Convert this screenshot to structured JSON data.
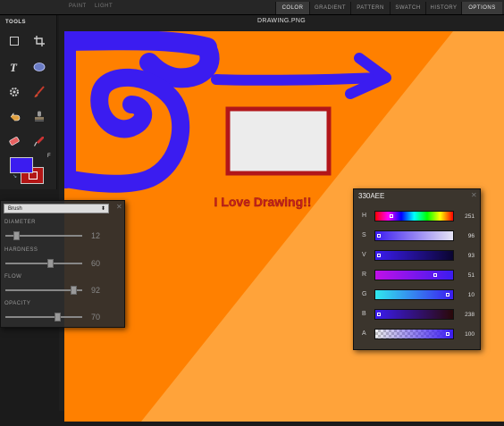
{
  "top_bar": {
    "modes": [
      "PAINT",
      "LIGHT"
    ],
    "tabs": [
      "COLOR",
      "GRADIENT",
      "PATTERN",
      "SWATCH",
      "HISTORY",
      "OPTIONS"
    ],
    "active_tabs": [
      "COLOR",
      "OPTIONS"
    ]
  },
  "tools": {
    "title": "TOOLS",
    "items": [
      "marquee-icon",
      "crop-icon",
      "text-icon",
      "ellipse-icon",
      "gear-icon",
      "brush-icon",
      "hand-undo-icon",
      "stamp-icon",
      "eraser-icon",
      "eyedropper-icon"
    ],
    "foreground_color": "#3b1cf0",
    "background_color": "#b31616",
    "f_label": "F"
  },
  "document": {
    "title": "DRAWING.PNG",
    "canvas_text": "I Love Drawing!!"
  },
  "brush_panel": {
    "type": "Brush",
    "settings": [
      {
        "label": "DIAMETER",
        "value": "12",
        "fraction": 0.12
      },
      {
        "label": "HARDNESS",
        "value": "60",
        "fraction": 0.6
      },
      {
        "label": "FLOW",
        "value": "92",
        "fraction": 0.92
      },
      {
        "label": "OPACITY",
        "value": "70",
        "fraction": 0.7
      }
    ]
  },
  "color_panel": {
    "hex": "330AEE",
    "channels": [
      {
        "label": "H",
        "value": "251",
        "fraction": 0.2
      },
      {
        "label": "S",
        "value": "96",
        "fraction": 0.02
      },
      {
        "label": "V",
        "value": "93",
        "fraction": 0.02
      },
      {
        "label": "R",
        "value": "51",
        "fraction": 0.8
      },
      {
        "label": "G",
        "value": "10",
        "fraction": 0.97
      },
      {
        "label": "B",
        "value": "238",
        "fraction": 0.02
      },
      {
        "label": "A",
        "value": "100",
        "fraction": 0.98
      }
    ]
  },
  "colors": {
    "canvas_orange": "#ff8000",
    "canvas_light_orange": "#ffa33a",
    "paint_blue": "#3b1cf0",
    "text_red": "#c8231c"
  }
}
